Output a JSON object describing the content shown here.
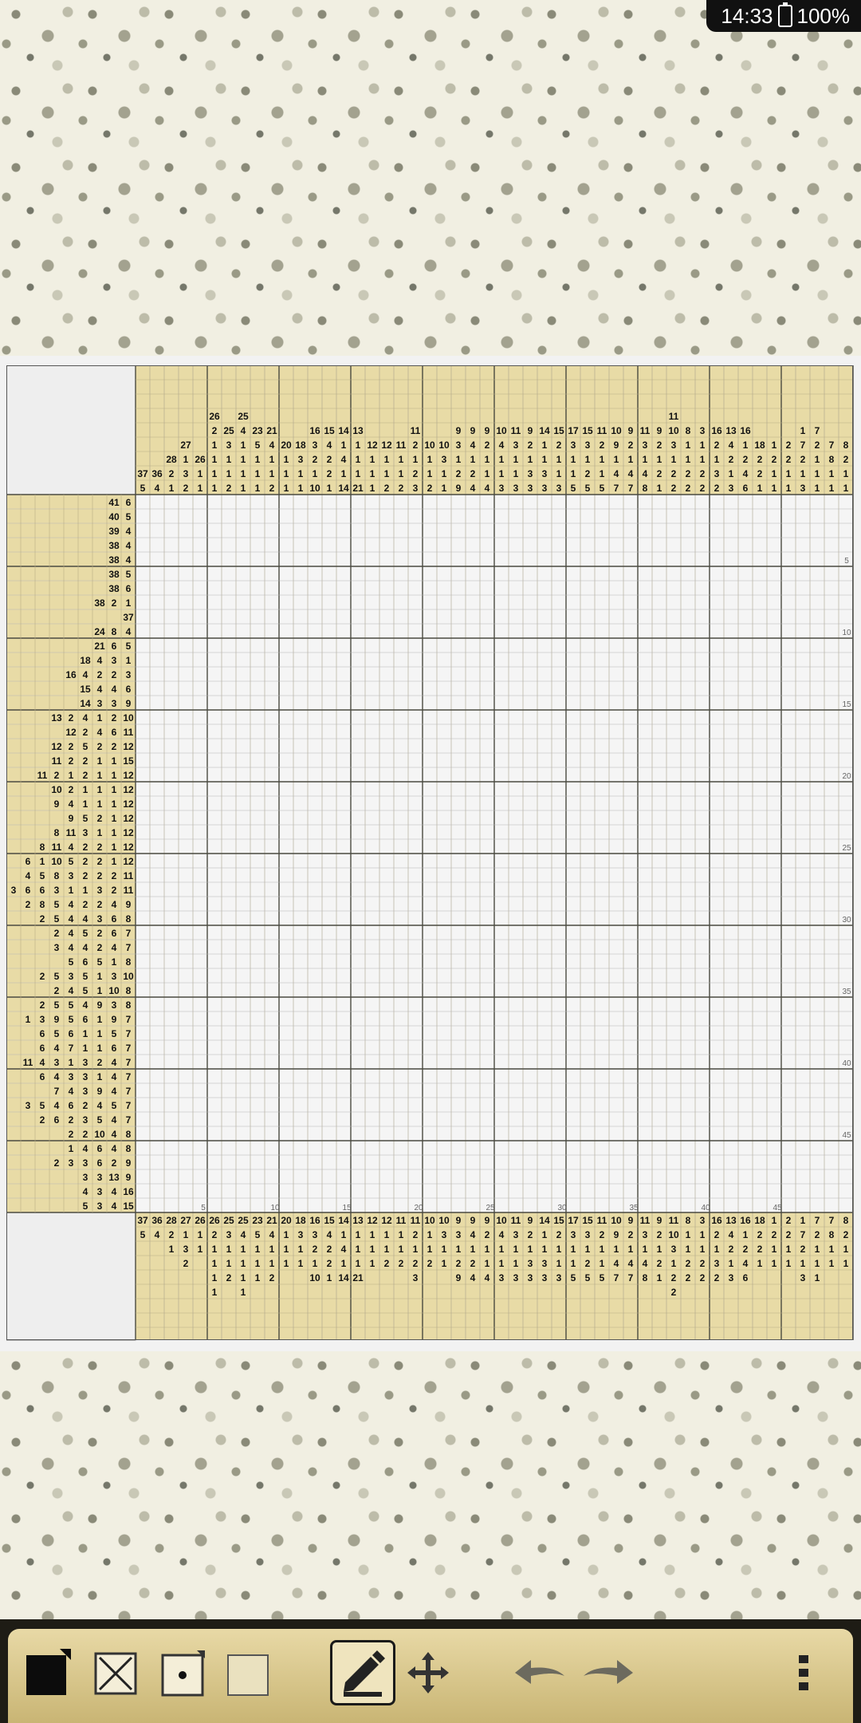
{
  "status_bar": {
    "time": "14:33",
    "battery": "100%"
  },
  "puzzle": {
    "rows": 50,
    "cols": 50,
    "column_clues": [
      [
        37,
        5
      ],
      [
        36,
        4
      ],
      [
        28,
        2,
        1
      ],
      [
        27,
        1,
        3,
        2
      ],
      [
        26,
        1,
        1
      ],
      [
        26,
        2,
        1,
        1,
        1,
        1
      ],
      [
        25,
        3,
        1,
        1,
        2
      ],
      [
        25,
        4,
        1,
        1,
        1,
        1
      ],
      [
        23,
        5,
        1,
        1,
        1
      ],
      [
        21,
        4,
        1,
        1,
        2
      ],
      [
        20,
        1,
        1,
        1
      ],
      [
        18,
        3,
        1,
        1
      ],
      [
        16,
        3,
        2,
        1,
        10
      ],
      [
        15,
        4,
        2,
        2,
        1
      ],
      [
        14,
        1,
        4,
        1,
        14
      ],
      [
        13,
        1,
        1,
        1,
        21
      ],
      [
        12,
        1,
        1,
        1
      ],
      [
        12,
        1,
        1,
        2
      ],
      [
        11,
        1,
        1,
        2
      ],
      [
        11,
        2,
        1,
        2,
        3
      ],
      [
        10,
        1,
        1,
        2
      ],
      [
        10,
        3,
        1,
        1
      ],
      [
        9,
        3,
        1,
        2,
        9
      ],
      [
        9,
        4,
        1,
        2,
        4
      ],
      [
        9,
        2,
        1,
        1,
        4
      ],
      [
        10,
        4,
        1,
        1,
        3
      ],
      [
        11,
        3,
        1,
        1,
        3
      ],
      [
        9,
        2,
        1,
        3,
        3
      ],
      [
        14,
        1,
        1,
        3,
        3
      ],
      [
        15,
        2,
        1,
        1,
        3
      ],
      [
        17,
        3,
        1,
        1,
        5
      ],
      [
        15,
        3,
        1,
        2,
        5
      ],
      [
        11,
        2,
        1,
        1,
        5
      ],
      [
        10,
        9,
        1,
        4,
        7
      ],
      [
        9,
        2,
        1,
        4,
        7
      ],
      [
        11,
        3,
        1,
        4,
        8
      ],
      [
        9,
        2,
        1,
        2,
        1
      ],
      [
        11,
        10,
        3,
        1,
        2,
        2
      ],
      [
        8,
        1,
        1,
        2,
        2
      ],
      [
        3,
        1,
        1,
        2,
        2
      ],
      [
        16,
        2,
        1,
        3,
        2
      ],
      [
        13,
        4,
        2,
        1,
        3
      ],
      [
        16,
        1,
        2,
        4,
        6
      ],
      [
        18,
        2,
        2,
        1
      ],
      [
        1,
        2,
        1,
        1
      ],
      [
        2,
        2,
        1,
        1
      ],
      [
        1,
        7,
        2,
        1,
        3
      ],
      [
        7,
        2,
        1,
        1,
        1
      ],
      [
        7,
        8,
        1,
        1
      ],
      [
        8,
        2,
        1,
        1
      ]
    ],
    "row_clues": [
      [
        41,
        6
      ],
      [
        40,
        5
      ],
      [
        39,
        4
      ],
      [
        38,
        4
      ],
      [
        38,
        4
      ],
      [
        38,
        5
      ],
      [
        38,
        6
      ],
      [
        38,
        2,
        1
      ],
      [
        37
      ],
      [
        24,
        8,
        4
      ],
      [
        21,
        6,
        5
      ],
      [
        18,
        4,
        3,
        1
      ],
      [
        16,
        4,
        2,
        2,
        3
      ],
      [
        15,
        4,
        4,
        6
      ],
      [
        14,
        3,
        3,
        9
      ],
      [
        13,
        2,
        4,
        1,
        2,
        10
      ],
      [
        12,
        2,
        4,
        6,
        11
      ],
      [
        12,
        2,
        5,
        2,
        2,
        12
      ],
      [
        11,
        2,
        2,
        1,
        1,
        15
      ],
      [
        11,
        2,
        1,
        2,
        1,
        1,
        12
      ],
      [
        10,
        2,
        1,
        1,
        1,
        12
      ],
      [
        9,
        4,
        1,
        1,
        1,
        12
      ],
      [
        9,
        5,
        2,
        1,
        12
      ],
      [
        8,
        11,
        3,
        1,
        1,
        12
      ],
      [
        8,
        11,
        4,
        2,
        2,
        1,
        12
      ],
      [
        6,
        1,
        10,
        5,
        2,
        2,
        1,
        12
      ],
      [
        4,
        5,
        8,
        3,
        2,
        2,
        2,
        11
      ],
      [
        3,
        6,
        6,
        3,
        1,
        1,
        3,
        2,
        11
      ],
      [
        2,
        8,
        5,
        4,
        2,
        2,
        4,
        9
      ],
      [
        2,
        5,
        4,
        4,
        3,
        6,
        8
      ],
      [
        2,
        4,
        5,
        2,
        6,
        7
      ],
      [
        3,
        4,
        4,
        2,
        4,
        7
      ],
      [
        5,
        6,
        5,
        1,
        8
      ],
      [
        2,
        5,
        3,
        5,
        1,
        3,
        10
      ],
      [
        2,
        4,
        5,
        1,
        10,
        8
      ],
      [
        2,
        5,
        5,
        4,
        9,
        3,
        8
      ],
      [
        1,
        3,
        9,
        5,
        6,
        1,
        9,
        7
      ],
      [
        6,
        5,
        6,
        1,
        1,
        5,
        7
      ],
      [
        6,
        4,
        7,
        1,
        1,
        6,
        7
      ],
      [
        11,
        4,
        3,
        1,
        3,
        2,
        4,
        7
      ],
      [
        6,
        4,
        3,
        3,
        1,
        4,
        7
      ],
      [
        7,
        4,
        3,
        9,
        4,
        7
      ],
      [
        3,
        5,
        4,
        6,
        2,
        4,
        5,
        7
      ],
      [
        2,
        6,
        2,
        3,
        5,
        4,
        7
      ],
      [
        2,
        2,
        10,
        4,
        8
      ],
      [
        1,
        4,
        6,
        4,
        8
      ],
      [
        2,
        3,
        3,
        6,
        2,
        9
      ],
      [
        3,
        3,
        13,
        9
      ],
      [
        4,
        3,
        4,
        16
      ],
      [
        5,
        3,
        4,
        15
      ]
    ],
    "column_number_markers": [
      "5",
      "10",
      "15",
      "20",
      "25",
      "30",
      "35",
      "40",
      "45"
    ],
    "row_number_markers": [
      "5",
      "10",
      "15",
      "20",
      "25",
      "30",
      "35",
      "40",
      "45"
    ]
  },
  "toolbar": {
    "tools": [
      "fill-square-tool",
      "cross-tool",
      "dot-tool",
      "empty-square-tool",
      "pencil-mode-tool",
      "move-tool",
      "undo",
      "redo",
      "more-menu"
    ],
    "selected": "pencil-mode-tool"
  },
  "colors": {
    "clue_bg": "#e8dba6",
    "grid_line": "#7d7a6a",
    "major_line": "#4a4a40",
    "cell_bg": "#f5f5f5"
  }
}
